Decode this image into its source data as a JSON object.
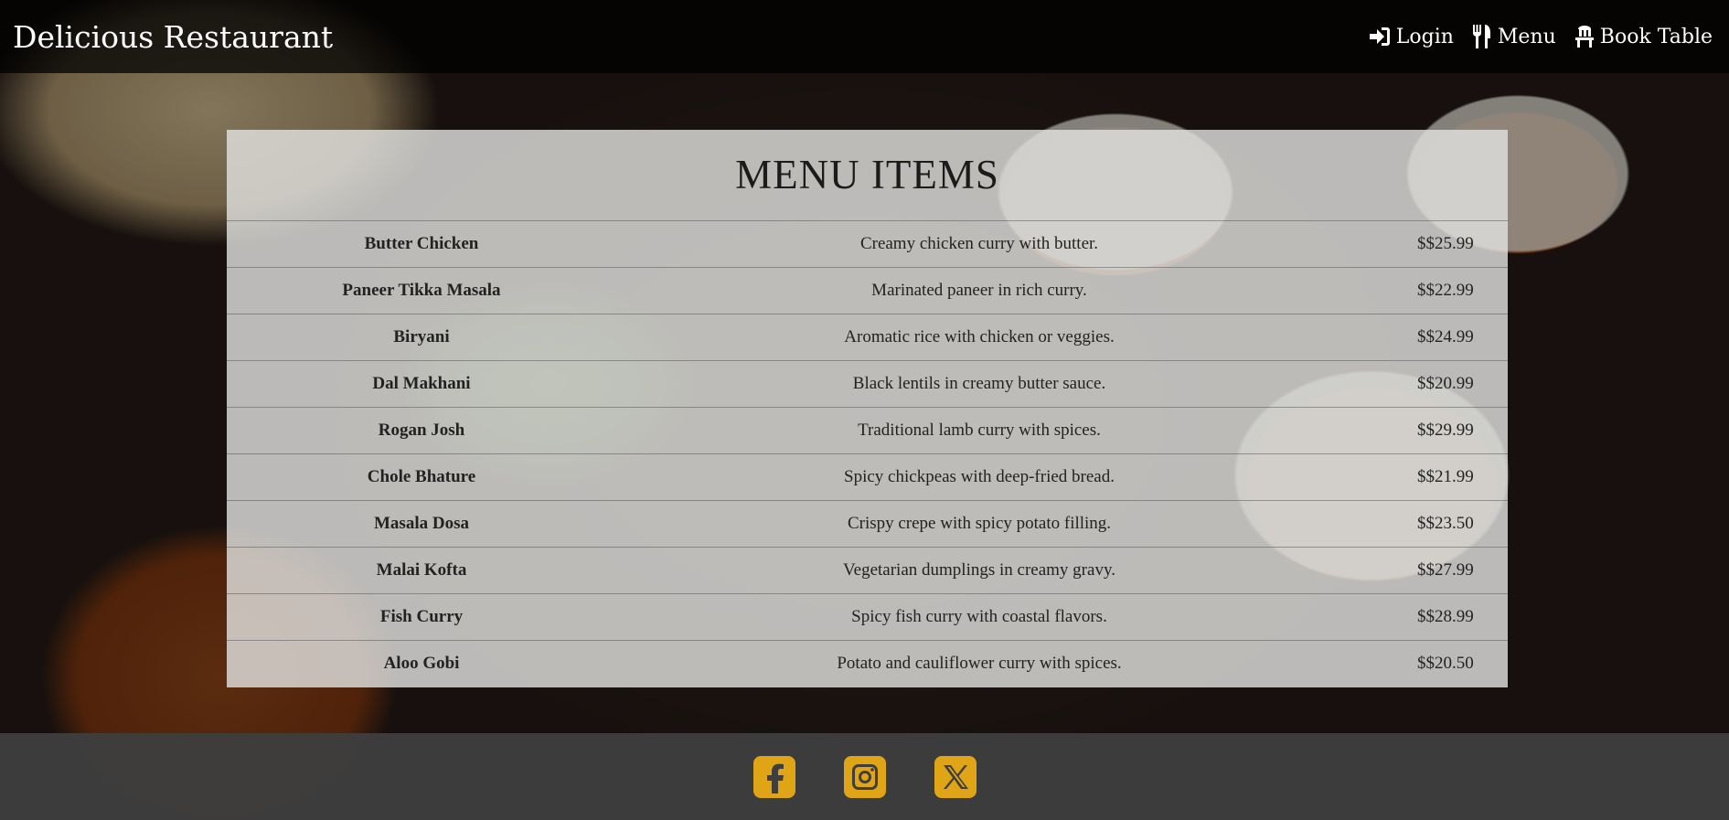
{
  "header": {
    "brand": "Delicious Restaurant",
    "nav": [
      {
        "label": "Login",
        "icon": "login-icon"
      },
      {
        "label": "Menu",
        "icon": "utensils-icon"
      },
      {
        "label": "Book Table",
        "icon": "chair-icon"
      }
    ]
  },
  "menu": {
    "title": "MENU ITEMS",
    "items": [
      {
        "name": "Butter Chicken",
        "description": "Creamy chicken curry with butter.",
        "price": "$$25.99"
      },
      {
        "name": "Paneer Tikka Masala",
        "description": "Marinated paneer in rich curry.",
        "price": "$$22.99"
      },
      {
        "name": "Biryani",
        "description": "Aromatic rice with chicken or veggies.",
        "price": "$$24.99"
      },
      {
        "name": "Dal Makhani",
        "description": "Black lentils in creamy butter sauce.",
        "price": "$$20.99"
      },
      {
        "name": "Rogan Josh",
        "description": "Traditional lamb curry with spices.",
        "price": "$$29.99"
      },
      {
        "name": "Chole Bhature",
        "description": "Spicy chickpeas with deep-fried bread.",
        "price": "$$21.99"
      },
      {
        "name": "Masala Dosa",
        "description": "Crispy crepe with spicy potato filling.",
        "price": "$$23.50"
      },
      {
        "name": "Malai Kofta",
        "description": "Vegetarian dumplings in creamy gravy.",
        "price": "$$27.99"
      },
      {
        "name": "Fish Curry",
        "description": "Spicy fish curry with coastal flavors.",
        "price": "$$28.99"
      },
      {
        "name": "Aloo Gobi",
        "description": "Potato and cauliflower curry with spices.",
        "price": "$$20.50"
      }
    ]
  },
  "footer": {
    "social": [
      {
        "icon": "facebook-icon"
      },
      {
        "icon": "instagram-icon"
      },
      {
        "icon": "x-twitter-icon"
      }
    ],
    "accent_color": "#e0a517"
  }
}
